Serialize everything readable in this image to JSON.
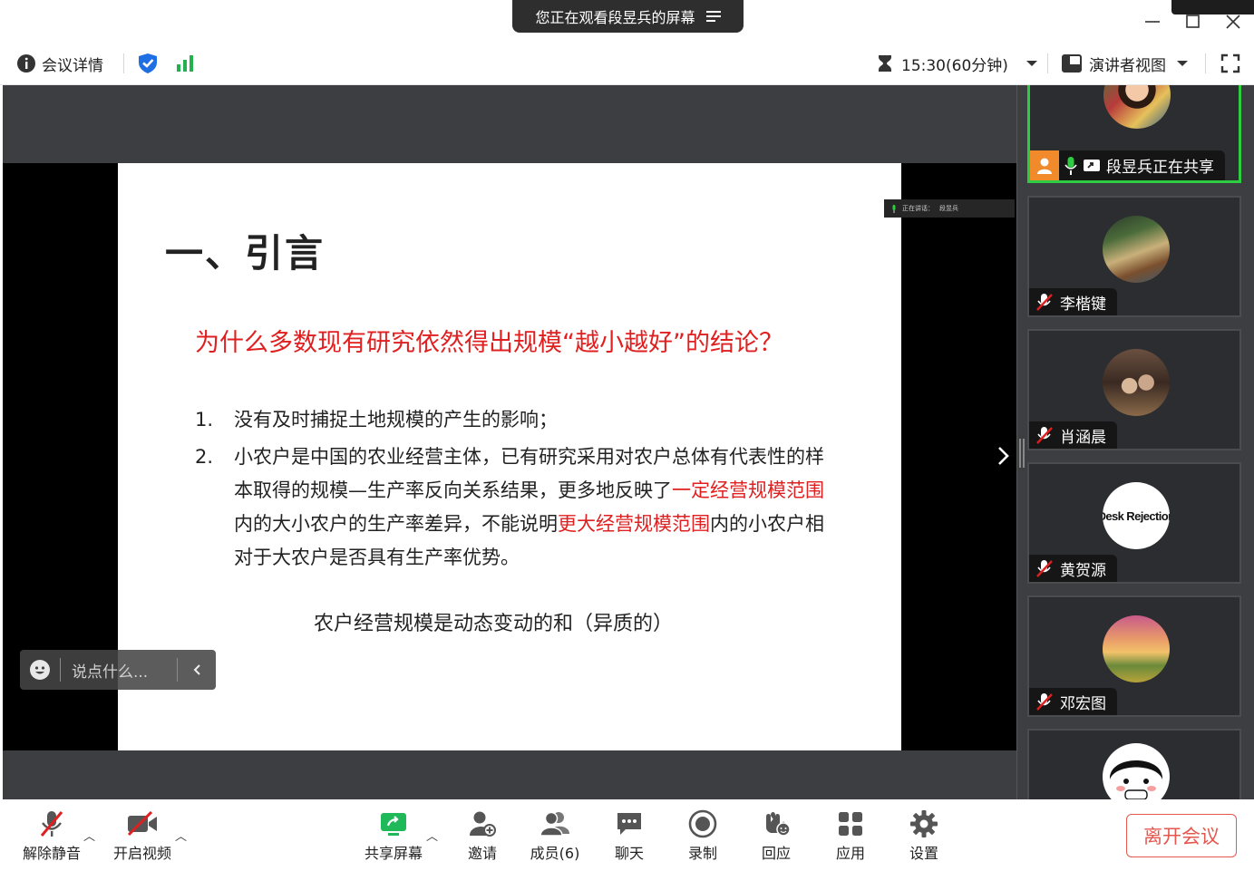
{
  "window": {
    "viewing_banner": "您正在观看段昱兵的屏幕"
  },
  "toolbar": {
    "meeting_details": "会议详情",
    "timer": "15:30(60分钟)",
    "view_mode": "演讲者视图"
  },
  "slide": {
    "title": "一、引言",
    "question": "为什么多数现有研究依然得出规模“越小越好”的结论？",
    "items": [
      {
        "num": "1.",
        "text": "没有及时捕捉土地规模的产生的影响；"
      },
      {
        "num": "2.",
        "part1": "小农户是中国的农业经营主体，已有研究采用对农户总体有代表性的样本取得的规模—生产率反向关系结果，更多地反映了",
        "red1": "一定经营规模范围",
        "part2": "内的大小农户的生产率差异，不能说明",
        "red2": "更大经营规模范围",
        "part3": "内的小农户相对于大农户是否具有生产率优势。"
      }
    ],
    "footer": "农户经营规模是动态变动的和（异质的）"
  },
  "speaker_mini": {
    "label": "正在讲话：",
    "name": "段昱兵"
  },
  "chat": {
    "placeholder": "说点什么..."
  },
  "participants": [
    {
      "name": "段昱兵正在共享",
      "sharing": true
    },
    {
      "name": "李楷键",
      "muted": true
    },
    {
      "name": "肖涵晨",
      "muted": true
    },
    {
      "name": "黄贺源",
      "muted": true,
      "avatar_text": "Desk Rejection"
    },
    {
      "name": "邓宏图",
      "muted": true
    },
    {
      "name": ""
    }
  ],
  "bottombar": {
    "unmute": "解除静音",
    "start_video": "开启视频",
    "share_screen": "共享屏幕",
    "invite": "邀请",
    "members": "成员(6)",
    "chat": "聊天",
    "record": "录制",
    "react": "回应",
    "apps": "应用",
    "settings": "设置",
    "leave": "离开会议"
  },
  "colors": {
    "accent_blue": "#1e6fe3",
    "signal_green": "#22b14c",
    "share_green": "#1fb95a",
    "active_border": "#2ecc40",
    "alert_red": "#e02020",
    "leave_red": "#e4574f"
  }
}
